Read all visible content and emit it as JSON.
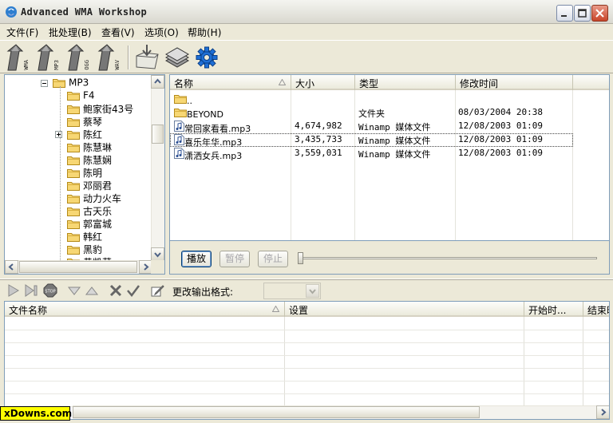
{
  "window": {
    "title": "Advanced WMA Workshop"
  },
  "menu": {
    "items": [
      {
        "label": "文件(F)"
      },
      {
        "label": "批处理(B)"
      },
      {
        "label": "查看(V)"
      },
      {
        "label": "选项(O)"
      },
      {
        "label": "帮助(H)"
      }
    ]
  },
  "toolbar": {
    "buttons": [
      {
        "name": "to-wma",
        "format": "WMA"
      },
      {
        "name": "to-mp3",
        "format": "MP3"
      },
      {
        "name": "to-ogg",
        "format": "OGG"
      },
      {
        "name": "to-wav",
        "format": "WAV"
      }
    ]
  },
  "tree": {
    "items": [
      {
        "label": "MP3",
        "level": 0,
        "expander": "minus"
      },
      {
        "label": "F4",
        "level": 1
      },
      {
        "label": "鲍家街43号",
        "level": 1
      },
      {
        "label": "蔡琴",
        "level": 1
      },
      {
        "label": "陈红",
        "level": 1,
        "expander": "plus"
      },
      {
        "label": "陈慧琳",
        "level": 1
      },
      {
        "label": "陈慧娴",
        "level": 1
      },
      {
        "label": "陈明",
        "level": 1
      },
      {
        "label": "邓丽君",
        "level": 1
      },
      {
        "label": "动力火车",
        "level": 1
      },
      {
        "label": "古天乐",
        "level": 1
      },
      {
        "label": "郭富城",
        "level": 1
      },
      {
        "label": "韩红",
        "level": 1
      },
      {
        "label": "黑豹",
        "level": 1
      },
      {
        "label": "黄凯芹",
        "level": 1
      }
    ]
  },
  "filelist": {
    "columns": [
      "名称",
      "大小",
      "类型",
      "修改时间"
    ],
    "rows": [
      {
        "icon": "folder",
        "name": "..",
        "size": "",
        "type": "",
        "modified": ""
      },
      {
        "icon": "folder",
        "name": "BEYOND",
        "size": "",
        "type": "文件夹",
        "modified": "08/03/2004 20:38"
      },
      {
        "icon": "audio",
        "name": "常回家看看.mp3",
        "size": "4,674,982",
        "type": "Winamp 媒体文件",
        "modified": "12/08/2003 01:09"
      },
      {
        "icon": "audio",
        "name": "喜乐年华.mp3",
        "size": "3,435,733",
        "type": "Winamp 媒体文件",
        "modified": "12/08/2003 01:09"
      },
      {
        "icon": "audio",
        "name": "潇洒女兵.mp3",
        "size": "3,559,031",
        "type": "Winamp 媒体文件",
        "modified": "12/08/2003 01:09"
      }
    ]
  },
  "player": {
    "play_label": "播放",
    "pause_label": "暂停",
    "stop_label": "停止",
    "position": 0
  },
  "toolbar2": {
    "format_label": "更改输出格式:",
    "format_value": ""
  },
  "grid": {
    "columns": [
      "文件名称",
      "设置",
      "开始时...",
      "结束时"
    ]
  },
  "watermark": "xDowns.com"
}
